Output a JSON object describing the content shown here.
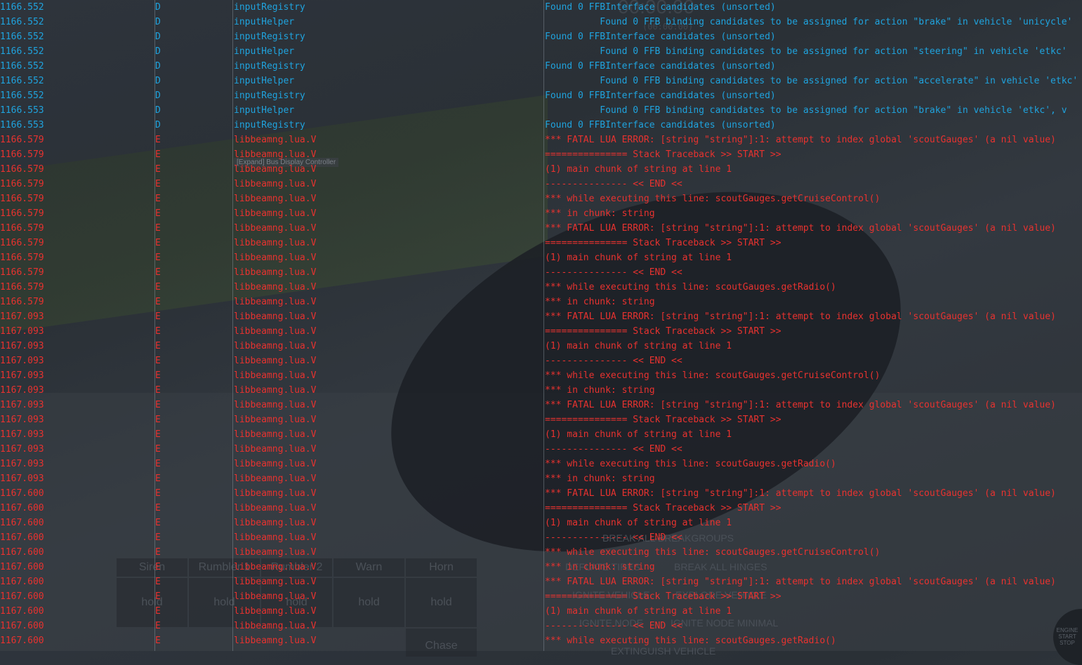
{
  "colors": {
    "debug": "#1fa3de",
    "error": "#e8322f"
  },
  "background_ui": {
    "timer": "00:00.00",
    "timer_sub": "(00:00:00)",
    "tooltip": "[Expand] Bus Display Controller",
    "buttons": [
      "Siren",
      "Rumbler 1",
      "Rumbler 2",
      "Warn",
      "Horn"
    ],
    "hold": [
      "hold",
      "hold",
      "hold",
      "hold",
      "hold"
    ],
    "chase": "Chase",
    "menu": [
      "BREAK ALL BREAKGROUPS",
      "DEFLATE TIRES",
      "BREAK ALL HINGES",
      "IGNITE VEHICLE",
      "EXPLODE VEHICLE",
      "IGNITE NODE",
      "IGNITE NODE MINIMAL",
      "EXTINGUISH VEHICLE"
    ],
    "engine": [
      "ENGINE",
      "START",
      "STOP"
    ]
  },
  "log": [
    {
      "ts": "1166.552",
      "lv": "D",
      "src": "inputRegistry",
      "msg": "Found 0 FFBInterface candidates (unsorted)"
    },
    {
      "ts": "1166.552",
      "lv": "D",
      "src": "inputHelper",
      "msg": "          Found 0 FFB binding candidates to be assigned for action \"brake\" in vehicle 'unicycle'"
    },
    {
      "ts": "1166.552",
      "lv": "D",
      "src": "inputRegistry",
      "msg": "Found 0 FFBInterface candidates (unsorted)"
    },
    {
      "ts": "1166.552",
      "lv": "D",
      "src": "inputHelper",
      "msg": "          Found 0 FFB binding candidates to be assigned for action \"steering\" in vehicle 'etkc'"
    },
    {
      "ts": "1166.552",
      "lv": "D",
      "src": "inputRegistry",
      "msg": "Found 0 FFBInterface candidates (unsorted)"
    },
    {
      "ts": "1166.552",
      "lv": "D",
      "src": "inputHelper",
      "msg": "          Found 0 FFB binding candidates to be assigned for action \"accelerate\" in vehicle 'etkc'"
    },
    {
      "ts": "1166.552",
      "lv": "D",
      "src": "inputRegistry",
      "msg": "Found 0 FFBInterface candidates (unsorted)"
    },
    {
      "ts": "1166.553",
      "lv": "D",
      "src": "inputHelper",
      "msg": "          Found 0 FFB binding candidates to be assigned for action \"brake\" in vehicle 'etkc', v"
    },
    {
      "ts": "1166.553",
      "lv": "D",
      "src": "inputRegistry",
      "msg": "Found 0 FFBInterface candidates (unsorted)"
    },
    {
      "ts": "1166.579",
      "lv": "E",
      "src": "libbeamng.lua.V",
      "msg": "*** FATAL LUA ERROR: [string \"string\"]:1: attempt to index global 'scoutGauges' (a nil value)"
    },
    {
      "ts": "1166.579",
      "lv": "E",
      "src": "libbeamng.lua.V",
      "msg": "=============== Stack Traceback >> START >>"
    },
    {
      "ts": "1166.579",
      "lv": "E",
      "src": "libbeamng.lua.V",
      "msg": "(1) main chunk of string at line 1"
    },
    {
      "ts": "1166.579",
      "lv": "E",
      "src": "libbeamng.lua.V",
      "msg": "--------------- << END <<"
    },
    {
      "ts": "1166.579",
      "lv": "E",
      "src": "libbeamng.lua.V",
      "msg": "*** while executing this line: scoutGauges.getCruiseControl()"
    },
    {
      "ts": "1166.579",
      "lv": "E",
      "src": "libbeamng.lua.V",
      "msg": "*** in chunk: string"
    },
    {
      "ts": "1166.579",
      "lv": "E",
      "src": "libbeamng.lua.V",
      "msg": "*** FATAL LUA ERROR: [string \"string\"]:1: attempt to index global 'scoutGauges' (a nil value)"
    },
    {
      "ts": "1166.579",
      "lv": "E",
      "src": "libbeamng.lua.V",
      "msg": "=============== Stack Traceback >> START >>"
    },
    {
      "ts": "1166.579",
      "lv": "E",
      "src": "libbeamng.lua.V",
      "msg": "(1) main chunk of string at line 1"
    },
    {
      "ts": "1166.579",
      "lv": "E",
      "src": "libbeamng.lua.V",
      "msg": "--------------- << END <<"
    },
    {
      "ts": "1166.579",
      "lv": "E",
      "src": "libbeamng.lua.V",
      "msg": "*** while executing this line: scoutGauges.getRadio()"
    },
    {
      "ts": "1166.579",
      "lv": "E",
      "src": "libbeamng.lua.V",
      "msg": "*** in chunk: string"
    },
    {
      "ts": "1167.093",
      "lv": "E",
      "src": "libbeamng.lua.V",
      "msg": "*** FATAL LUA ERROR: [string \"string\"]:1: attempt to index global 'scoutGauges' (a nil value)"
    },
    {
      "ts": "1167.093",
      "lv": "E",
      "src": "libbeamng.lua.V",
      "msg": "=============== Stack Traceback >> START >>"
    },
    {
      "ts": "1167.093",
      "lv": "E",
      "src": "libbeamng.lua.V",
      "msg": "(1) main chunk of string at line 1"
    },
    {
      "ts": "1167.093",
      "lv": "E",
      "src": "libbeamng.lua.V",
      "msg": "--------------- << END <<"
    },
    {
      "ts": "1167.093",
      "lv": "E",
      "src": "libbeamng.lua.V",
      "msg": "*** while executing this line: scoutGauges.getCruiseControl()"
    },
    {
      "ts": "1167.093",
      "lv": "E",
      "src": "libbeamng.lua.V",
      "msg": "*** in chunk: string"
    },
    {
      "ts": "1167.093",
      "lv": "E",
      "src": "libbeamng.lua.V",
      "msg": "*** FATAL LUA ERROR: [string \"string\"]:1: attempt to index global 'scoutGauges' (a nil value)"
    },
    {
      "ts": "1167.093",
      "lv": "E",
      "src": "libbeamng.lua.V",
      "msg": "=============== Stack Traceback >> START >>"
    },
    {
      "ts": "1167.093",
      "lv": "E",
      "src": "libbeamng.lua.V",
      "msg": "(1) main chunk of string at line 1"
    },
    {
      "ts": "1167.093",
      "lv": "E",
      "src": "libbeamng.lua.V",
      "msg": "--------------- << END <<"
    },
    {
      "ts": "1167.093",
      "lv": "E",
      "src": "libbeamng.lua.V",
      "msg": "*** while executing this line: scoutGauges.getRadio()"
    },
    {
      "ts": "1167.093",
      "lv": "E",
      "src": "libbeamng.lua.V",
      "msg": "*** in chunk: string"
    },
    {
      "ts": "1167.600",
      "lv": "E",
      "src": "libbeamng.lua.V",
      "msg": "*** FATAL LUA ERROR: [string \"string\"]:1: attempt to index global 'scoutGauges' (a nil value)"
    },
    {
      "ts": "1167.600",
      "lv": "E",
      "src": "libbeamng.lua.V",
      "msg": "=============== Stack Traceback >> START >>"
    },
    {
      "ts": "1167.600",
      "lv": "E",
      "src": "libbeamng.lua.V",
      "msg": "(1) main chunk of string at line 1"
    },
    {
      "ts": "1167.600",
      "lv": "E",
      "src": "libbeamng.lua.V",
      "msg": "--------------- << END <<"
    },
    {
      "ts": "1167.600",
      "lv": "E",
      "src": "libbeamng.lua.V",
      "msg": "*** while executing this line: scoutGauges.getCruiseControl()"
    },
    {
      "ts": "1167.600",
      "lv": "E",
      "src": "libbeamng.lua.V",
      "msg": "*** in chunk: string"
    },
    {
      "ts": "1167.600",
      "lv": "E",
      "src": "libbeamng.lua.V",
      "msg": "*** FATAL LUA ERROR: [string \"string\"]:1: attempt to index global 'scoutGauges' (a nil value)"
    },
    {
      "ts": "1167.600",
      "lv": "E",
      "src": "libbeamng.lua.V",
      "msg": "=============== Stack Traceback >> START >>"
    },
    {
      "ts": "1167.600",
      "lv": "E",
      "src": "libbeamng.lua.V",
      "msg": "(1) main chunk of string at line 1"
    },
    {
      "ts": "1167.600",
      "lv": "E",
      "src": "libbeamng.lua.V",
      "msg": "--------------- << END <<"
    },
    {
      "ts": "1167.600",
      "lv": "E",
      "src": "libbeamng.lua.V",
      "msg": "*** while executing this line: scoutGauges.getRadio()"
    }
  ]
}
